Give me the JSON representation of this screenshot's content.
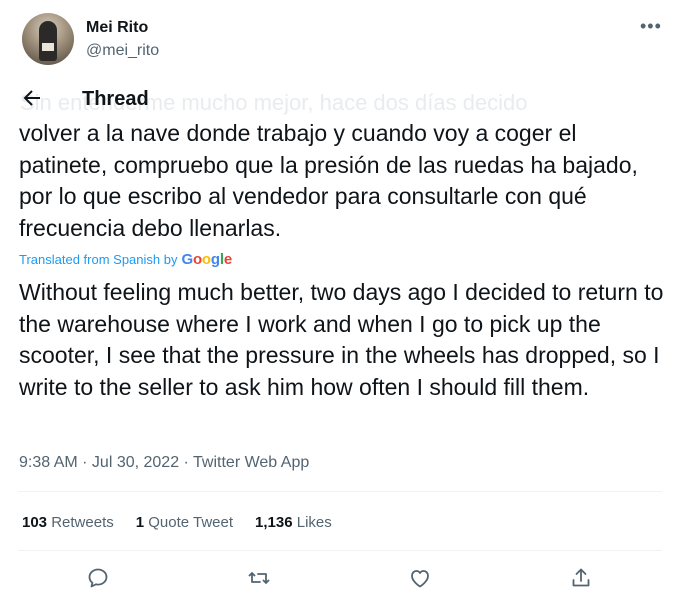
{
  "author": {
    "name": "Mei Rito",
    "handle": "@mei_rito"
  },
  "header": {
    "title": "Thread",
    "faded_text": "Sin entenderme mucho mejor, hace dos días decido"
  },
  "tweet": {
    "original_text": "volver a la nave donde trabajo y cuando voy a coger el patinete, compruebo que la presión de las ruedas ha bajado, por lo que escribo al vendedor para consultarle con qué frecuencia debo llenarlas.",
    "translated_from": "Translated from Spanish by",
    "translator_brand": "Google",
    "translated_text": "Without feeling much better, two days ago I decided to return to the warehouse where I work and when I go to pick up the scooter, I see that the pressure in the wheels has dropped, so I write to the seller to ask him how often I should fill them.",
    "meta": "9:38 AM · Jul 30, 2022 · Twitter Web App"
  },
  "stats": {
    "retweets_count": "103",
    "retweets_label": "Retweets",
    "quotes_count": "1",
    "quotes_label": "Quote Tweet",
    "likes_count": "1,136",
    "likes_label": "Likes"
  },
  "colors": {
    "accent": "#1d9bf0",
    "secondary_text": "#536471",
    "primary_text": "#0f1419"
  },
  "icons": {
    "back": "arrow-left-icon",
    "more": "more-horizontal-icon",
    "reply": "reply-icon",
    "retweet": "retweet-icon",
    "like": "heart-icon",
    "share": "share-icon"
  }
}
